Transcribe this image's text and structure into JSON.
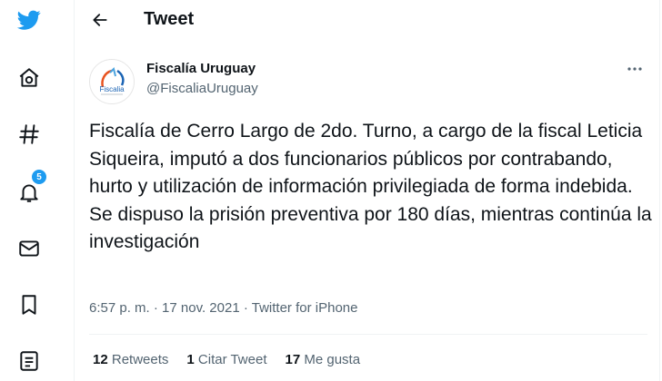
{
  "header": {
    "title": "Tweet"
  },
  "sidebar": {
    "notification_badge": "5"
  },
  "tweet": {
    "author_name": "Fiscalía Uruguay",
    "author_handle": "@FiscaliaUruguay",
    "avatar_text": "Fiscalia",
    "text": "Fiscalía de Cerro Largo de 2do. Turno, a cargo de la fiscal Leticia Siqueira, imputó a dos funcionarios públicos por contrabando, hurto y utilización de información privilegiada de forma indebida. Se dispuso la prisión preventiva por 180 días, mientras continúa la investigación",
    "time": "6:57 p. m.",
    "separator": " · ",
    "date": "17 nov. 2021",
    "source": "Twitter for iPhone"
  },
  "stats": {
    "retweets_count": "12",
    "retweets_label": "Retweets",
    "quotes_count": "1",
    "quotes_label": "Citar Tweet",
    "likes_count": "17",
    "likes_label": "Me gusta"
  },
  "colors": {
    "accent": "#1d9bf0",
    "text": "#0f1419",
    "secondary": "#536471",
    "border": "#eff3f4"
  }
}
